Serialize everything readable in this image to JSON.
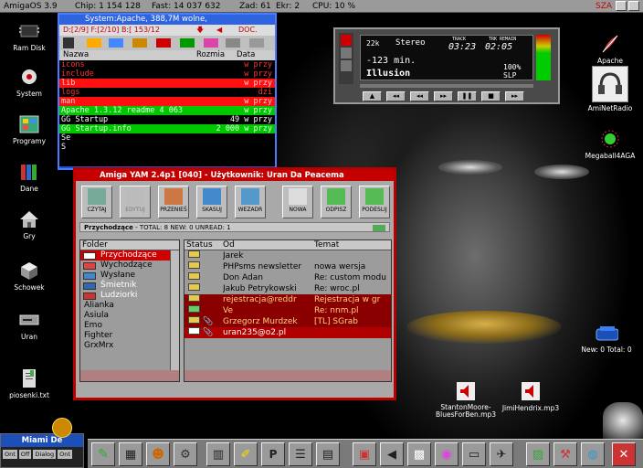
{
  "topbar": {
    "os": "AmigaOS 3.9",
    "chip": "Chip: 1 154 128",
    "fast": "Fast: 14 037 632",
    "zad": "Zad: 61",
    "ekr": "Ekr: 2",
    "cpu": "CPU: 10 %",
    "sza": "SZA"
  },
  "desktop_left": [
    {
      "label": "Ram Disk",
      "icon": "ram-disk-icon"
    },
    {
      "label": "System",
      "icon": "system-drive-icon"
    },
    {
      "label": "Programy",
      "icon": "programs-drawer-icon"
    },
    {
      "label": "Dane",
      "icon": "books-icon"
    },
    {
      "label": "Gry",
      "icon": "house-icon"
    },
    {
      "label": "Schowek",
      "icon": "cube-icon"
    },
    {
      "label": "Uran",
      "icon": "drive-icon"
    },
    {
      "label": "piosenki.txt",
      "icon": "text-file-icon"
    }
  ],
  "desktop_right": [
    {
      "label": "Apache",
      "icon": "feather-icon"
    },
    {
      "label": "AmiNetRadio",
      "icon": "headphones-icon"
    },
    {
      "label": "Megaball4AGA",
      "icon": "ball-icon"
    },
    {
      "label": "New: 0 Total: 0",
      "icon": "mailbox-icon"
    },
    {
      "label": "StantonMoore-BluesForBen.mp3",
      "icon": "speaker-icon"
    },
    {
      "label": "JimiHendrix.mp3",
      "icon": "speaker-icon"
    }
  ],
  "dirwin": {
    "title": "System:Apache, 388,7M wolne,",
    "path": "D:[2/9] F:[2/10] B:[ 153/12",
    "doc": "DOC.",
    "col_name": "Nazwa",
    "col_size": "Rozmia",
    "col_date": "Data",
    "rows": [
      {
        "name": "icons",
        "right": "w przy"
      },
      {
        "name": "include",
        "right": "w przy"
      },
      {
        "name": "lib",
        "right": "w przy"
      },
      {
        "name": "logs",
        "right": "dzi"
      },
      {
        "name": "man",
        "right": "w przy"
      },
      {
        "name": "Apache 1.3.12 readme 4 063",
        "right": "w przy"
      },
      {
        "name": "GG Startup",
        "right": "49 w przy"
      },
      {
        "name": "GG Startup.info",
        "right": "2 000 w przy"
      },
      {
        "name": "Se",
        "right": ""
      },
      {
        "name": "S",
        "right": ""
      }
    ]
  },
  "yam": {
    "title": "Amiga YAM 2.4p1 [040]  -  Użytkownik: Uran Da Peacema",
    "buttons": [
      "CZYTAJ",
      "EDYTUJ",
      "PRZENIEŚ",
      "SKASUJ",
      "WEZADR",
      "NOWA",
      "ODPISZ",
      "PODESLIJ"
    ],
    "status_prefix": "Przychodzące",
    "status_rest": " - TOTAL: 8 NEW: 0 UNREAD: 1",
    "folder_header": "Folder",
    "folders": [
      "Przychodzące",
      "Wychodzące",
      "Wysłane",
      "Śmietnik",
      "Ludziorki",
      "Alianka",
      "Asiula",
      "Emo",
      "Fighter",
      "GrxMrx"
    ],
    "col_status": "Status",
    "col_from": "Od",
    "col_subject": "Temat",
    "messages": [
      {
        "from": "Jarek",
        "subject": ""
      },
      {
        "from": "PHPsms newsletter",
        "subject": "nowa wersja"
      },
      {
        "from": "Don Adan",
        "subject": "Re: custom modu"
      },
      {
        "from": "Jakub Petrykowski",
        "subject": "Re: wroc.pl"
      },
      {
        "from": "rejestracja@reddr",
        "subject": "Rejestracja w gr"
      },
      {
        "from": "Ve",
        "subject": "Re: nnm.pl"
      },
      {
        "from": "Grzegorz Murdzek",
        "subject": "[TL] SGrab"
      },
      {
        "from": "uran235@o2.pl",
        "subject": ""
      }
    ]
  },
  "player": {
    "rate": "22k",
    "mode": "Stereo",
    "track_label": "TRACK",
    "remain_label": "TRK REMAIN",
    "track_time": "03:23",
    "remain_time": "02:05",
    "minutes": "-123 min.",
    "title": "Illusion",
    "vol": "100%",
    "slp": "SLP"
  },
  "clock": {
    "city": "Miami De",
    "on": "Ont",
    "off": "Off",
    "dialog": "Dialog",
    "ont": "Ont"
  },
  "colors": {
    "dir_blue": "#1e4fc8",
    "yam_red": "#c40000",
    "selected_red": "#ff1010",
    "green_row": "#00c800",
    "text_red": "#ff4040"
  }
}
